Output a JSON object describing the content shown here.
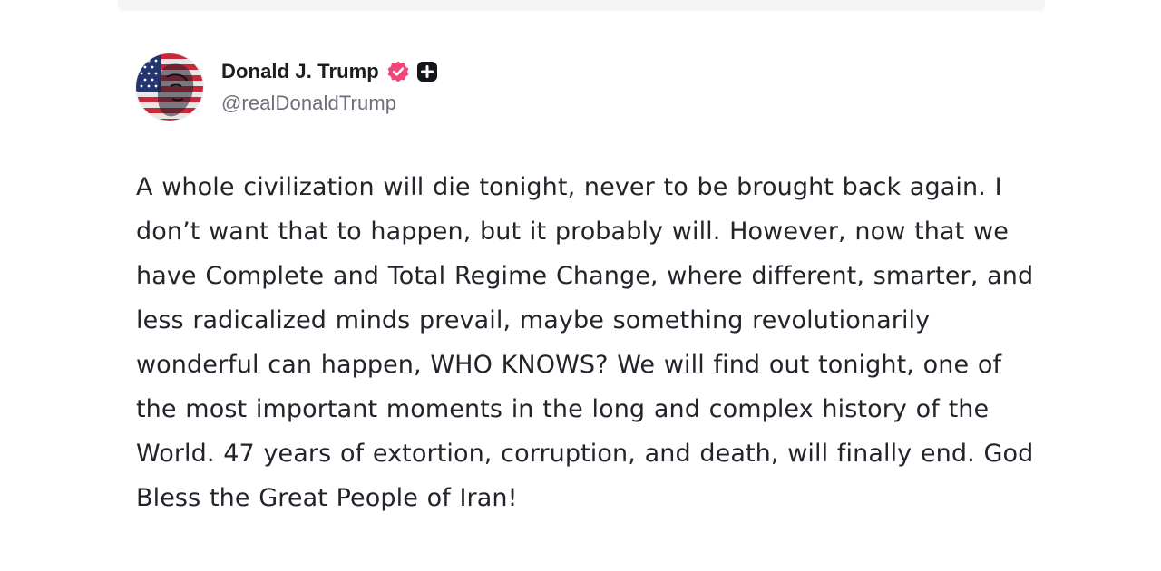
{
  "post": {
    "author": {
      "display_name": "Donald J. Trump",
      "handle": "@realDonaldTrump",
      "avatar_icon": "flag-portrait-avatar",
      "verified_icon": "verified-badge-icon",
      "plus_icon": "plus-badge-icon"
    },
    "text": "A whole civilization will die tonight, never to be brought back again. I don’t want that to happen, but it probably will. However, now that we have Complete and Total Regime Change, where different, smarter, and less radicalized minds prevail, maybe something revolutionarily wonderful can happen, WHO KNOWS? We will find out tonight, one of the most important moments in the long and complex history of the World. 47 years of extortion, corruption, and death, will finally end. God Bless the Great People of Iran!"
  },
  "colors": {
    "verified_pink": "#f0467a",
    "text": "#23232b",
    "handle": "#6b6f7a",
    "plus_badge": "#15151b"
  }
}
